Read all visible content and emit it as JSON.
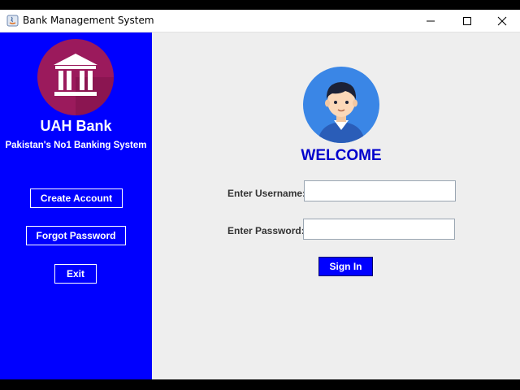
{
  "window": {
    "title": "Bank Management System",
    "controls": {
      "minimize": "minimize",
      "maximize": "maximize",
      "close": "close"
    }
  },
  "sidebar": {
    "logo_icon": "bank-building-icon",
    "bank_name": "UAH Bank",
    "tagline": "Pakistan's No1 Banking System",
    "buttons": {
      "create_account": "Create Account",
      "forgot_password": "Forgot Password",
      "exit": "Exit"
    }
  },
  "main": {
    "avatar_icon": "user-avatar-icon",
    "welcome": "WELCOME",
    "username": {
      "label": "Enter Username:",
      "value": ""
    },
    "password": {
      "label": "Enter Password:",
      "value": ""
    },
    "signin_label": "Sign In"
  },
  "colors": {
    "sidebar": "#0000ff",
    "logo_circle": "#9b1a5c",
    "avatar_circle": "#3a86e6",
    "welcome_text": "#0000cc",
    "signin_button": "#0000ff"
  }
}
